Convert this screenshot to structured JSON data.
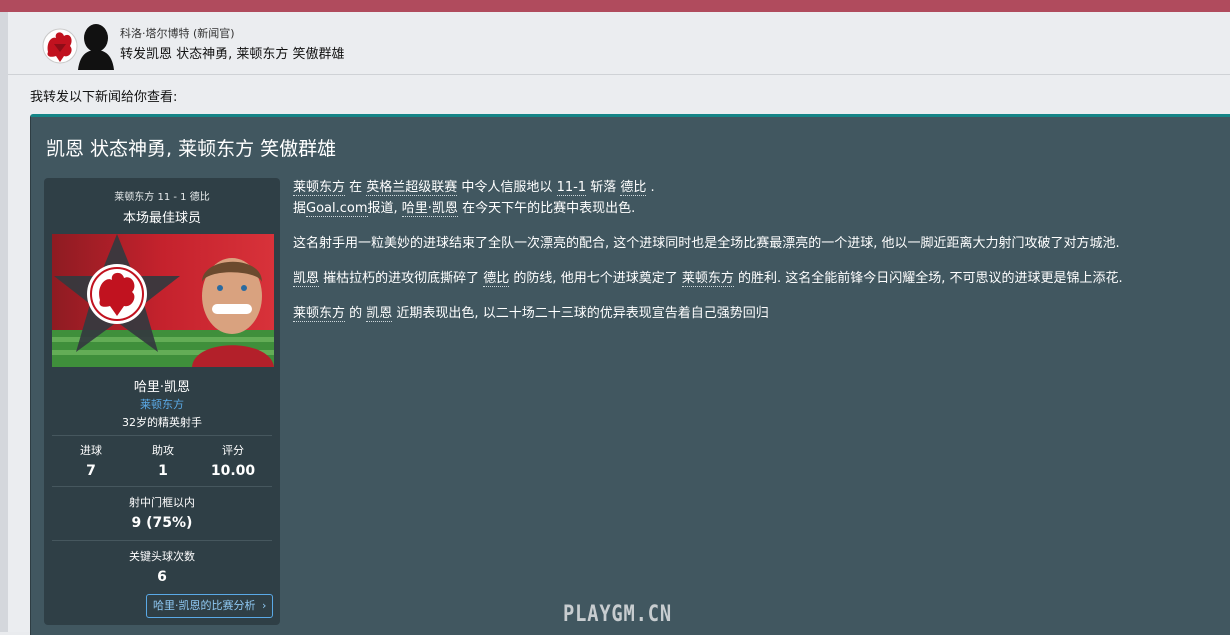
{
  "message": {
    "sender": "科洛·塔尔博特 (新闻官)",
    "subject": "转发凯恩 状态神勇, 莱顿东方 笑傲群雄",
    "intro": "我转发以下新闻给你查看:"
  },
  "news": {
    "headline": "凯恩 状态神勇, 莱顿东方 笑傲群雄",
    "p1": {
      "team": "莱顿东方",
      "t1": " 在 ",
      "league": "英格兰超级联赛",
      "t2": " 中令人信服地以 ",
      "score": "11-1",
      "t3": " 斩落 ",
      "opponent": "德比",
      "t4": " .",
      "t5": "据",
      "source": "Goal.com",
      "t6": "报道, ",
      "player": "哈里·凯恩",
      "t7": " 在今天下午的比赛中表现出色."
    },
    "p2": "这名射手用一粒美妙的进球结束了全队一次漂亮的配合, 这个进球同时也是全场比赛最漂亮的一个进球, 他以一脚近距离大力射门攻破了对方城池.",
    "p3": {
      "player": "凯恩",
      "t1": " 摧枯拉朽的进攻彻底撕碎了 ",
      "opponent": "德比",
      "t2": " 的防线, 他用七个进球奠定了 ",
      "team": "莱顿东方",
      "t3": " 的胜利. 这名全能前锋今日闪耀全场, 不可思议的进球更是锦上添花."
    },
    "p4": {
      "team": "莱顿东方",
      "t1": " 的 ",
      "player": "凯恩",
      "t2": " 近期表现出色, 以二十场二十三球的优异表现宣告着自己强势回归"
    }
  },
  "player_card": {
    "match": "莱顿东方 11 - 1 德比",
    "award": "本场最佳球员",
    "name": "哈里·凯恩",
    "team": "莱顿东方",
    "description": "32岁的精英射手",
    "stats": [
      {
        "label": "进球",
        "value": "7"
      },
      {
        "label": "助攻",
        "value": "1"
      },
      {
        "label": "评分",
        "value": "10.00"
      }
    ],
    "shots_label": "射中门框以内",
    "shots_value": "9 (75%)",
    "headers_label": "关键头球次数",
    "headers_value": "6",
    "analysis_button": "哈里·凯恩的比赛分析",
    "analysis_icon": "chevron-right-icon",
    "crest_icon": "leyton-orient-crest-icon",
    "player_photo": "player-photo"
  },
  "watermark": "PLAYGM.CN",
  "colors": {
    "top_bar": "#b04b5d",
    "card_bg": "#415760",
    "card_accent": "#158587",
    "panel_bg": "#2f3f46",
    "link_blue": "#5aa9e6"
  }
}
